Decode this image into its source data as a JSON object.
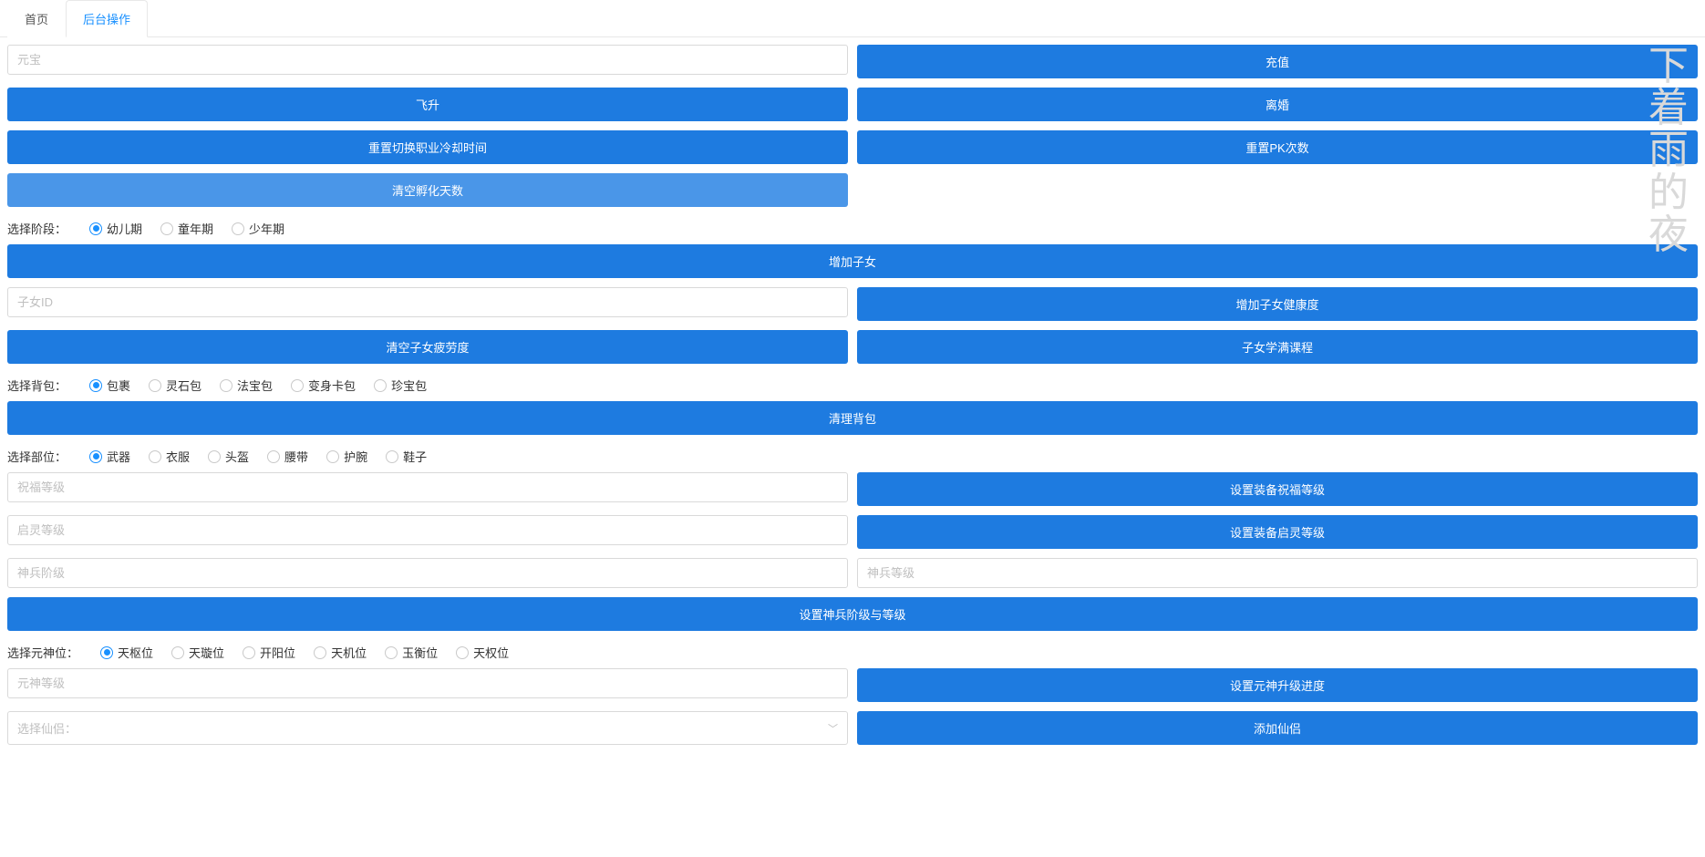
{
  "tabs": {
    "home": "首页",
    "admin": "后台操作"
  },
  "watermark": "下着雨的夜",
  "inputs": {
    "yuanbao": "元宝",
    "child_id": "子女ID",
    "bless_level": "祝福等级",
    "spirit_level": "启灵等级",
    "weapon_stage": "神兵阶级",
    "weapon_level": "神兵等级",
    "soul_level": "元神等级",
    "select_partner": "选择仙侣："
  },
  "buttons": {
    "recharge": "充值",
    "ascend": "飞升",
    "divorce": "离婚",
    "reset_job_cd": "重置切换职业冷却时间",
    "reset_pk": "重置PK次数",
    "clear_hatch_days": "清空孵化天数",
    "add_child": "增加子女",
    "add_child_health": "增加子女健康度",
    "clear_child_fatigue": "清空子女疲劳度",
    "child_full_course": "子女学满课程",
    "clear_bag": "清理背包",
    "set_equip_bless": "设置装备祝福等级",
    "set_equip_spirit": "设置装备启灵等级",
    "set_weapon_stage_level": "设置神兵阶级与等级",
    "set_soul_progress": "设置元神升级进度",
    "add_partner": "添加仙侣"
  },
  "radios": {
    "stage": {
      "label": "选择阶段：",
      "options": [
        "幼儿期",
        "童年期",
        "少年期"
      ]
    },
    "bag": {
      "label": "选择背包：",
      "options": [
        "包裹",
        "灵石包",
        "法宝包",
        "变身卡包",
        "珍宝包"
      ]
    },
    "slot": {
      "label": "选择部位：",
      "options": [
        "武器",
        "衣服",
        "头盔",
        "腰带",
        "护腕",
        "鞋子"
      ]
    },
    "soul": {
      "label": "选择元神位：",
      "options": [
        "天枢位",
        "天璇位",
        "开阳位",
        "天机位",
        "玉衡位",
        "天权位"
      ]
    }
  }
}
